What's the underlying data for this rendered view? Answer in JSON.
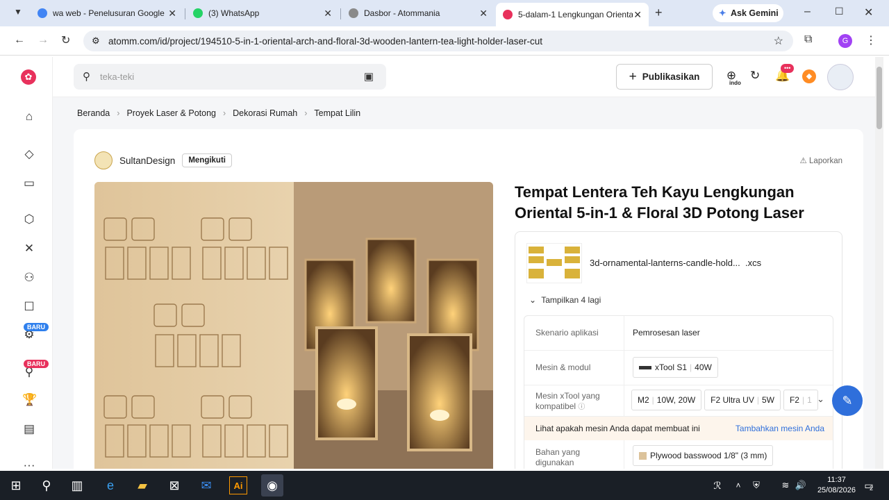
{
  "browser": {
    "tabs": [
      {
        "title": "wa web - Penelusuran Google",
        "color": "#4285f4"
      },
      {
        "title": "(3) WhatsApp",
        "color": "#25d366"
      },
      {
        "title": "Dasbor - Atommania",
        "color": "#8a8a8a"
      },
      {
        "title": "5-dalam-1 Lengkungan Orienta",
        "color": "#e8315c"
      }
    ],
    "gemini": "Ask Gemini",
    "url": "atomm.com/id/project/194510-5-in-1-oriental-arch-and-floral-3d-wooden-lantern-tea-light-holder-laser-cut",
    "profile": "G"
  },
  "site": {
    "search_placeholder": "teka-teki",
    "publish": "Publikasikan",
    "lang": "indo",
    "notif_badge": "•••",
    "nav_badges": [
      "BARU",
      "BARU"
    ],
    "brand_color": "#e8315c"
  },
  "breadcrumb": [
    "Beranda",
    "Proyek Laser & Potong",
    "Dekorasi Rumah",
    "Tempat Lilin"
  ],
  "project": {
    "author": "SultanDesign",
    "follow": "Mengikuti",
    "report": "Laporkan",
    "title": "Tempat Lentera Teh Kayu Lengkungan Oriental 5-in-1 & Floral 3D Potong Laser",
    "file_name": "3d-ornamental-lanterns-candle-hold...",
    "file_ext": ".xcs",
    "show_more": "Tampilkan 4 lagi",
    "specs": {
      "scenario_label": "Skenario aplikasi",
      "scenario_value": "Pemrosesan laser",
      "machine_label": "Mesin & modul",
      "machine_value": "xTool S1",
      "machine_power": "40W",
      "compat_label": "Mesin xTool yang kompatibel",
      "compat": [
        {
          "name": "M2",
          "power": "10W, 20W"
        },
        {
          "name": "F2 Ultra UV",
          "power": "5W"
        },
        {
          "name": "F2",
          "power": "1"
        }
      ],
      "note": "Lihat apakah mesin Anda dapat membuat ini",
      "note_link": "Tambahkan mesin Anda",
      "material_label": "Bahan yang digunakan",
      "material_value": "Plywood basswood 1/8\" (3 mm)"
    }
  },
  "taskbar": {
    "time": "11:37",
    "date": "25/08/2026",
    "notif_count": "2"
  }
}
